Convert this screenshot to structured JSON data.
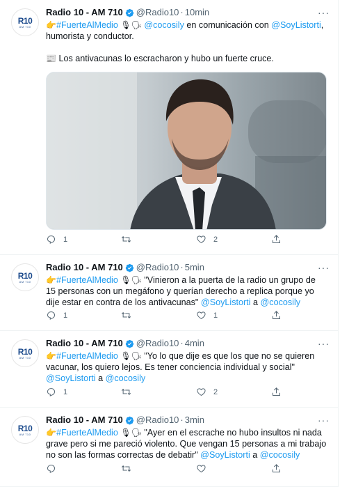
{
  "account": {
    "name": "Radio 10 - AM 710",
    "handle": "@Radio10",
    "avatar_text": "R10",
    "avatar_sub": "AM 710"
  },
  "brand_colors": {
    "link": "#1d9bf0",
    "verified": "#1d9bf0",
    "text": "#0f1419",
    "muted": "#536471"
  },
  "tweets": [
    {
      "time": "10min",
      "hashtag": "#FuerteAlMedio",
      "body": " en comunicación con ",
      "mention1": "@cocosily",
      "mention2": "@SoyListorti",
      "tail": ", humorista y conductor.",
      "para2": "Los antivacunas lo escracharon y hubo un fuerte cruce.",
      "replies": "1",
      "retweets": "",
      "likes": "2"
    },
    {
      "time": "5min",
      "hashtag": "#FuerteAlMedio",
      "body": " \"Vinieron a la puerta de la radio un grupo de 15 personas con un megáfono y querían derecho a replica porque yo dije estar en contra de los antivacunas\" ",
      "mention1": "@SoyListorti",
      "connector": " a ",
      "mention2": "@cocosily",
      "replies": "1",
      "retweets": "",
      "likes": "1"
    },
    {
      "time": "4min",
      "hashtag": "#FuerteAlMedio",
      "body": " \"Yo lo que dije es que los que no se quieren vacunar, los quiero lejos. Es tener conciencia individual y social\" ",
      "mention1": "@SoyListorti",
      "connector": " a ",
      "mention2": "@cocosily",
      "replies": "1",
      "retweets": "",
      "likes": "2"
    },
    {
      "time": "3min",
      "hashtag": "#FuerteAlMedio",
      "body": " \"Ayer en el escrache no hubo insultos ni nada grave pero si me pareció violento. Que vengan 15 personas a mi trabajo no son las formas correctas de debatir\" ",
      "mention1": "@SoyListorti",
      "connector": " a ",
      "mention2": "@cocosily",
      "replies": "",
      "retweets": "",
      "likes": ""
    }
  ],
  "glyphs": {
    "more": "···",
    "dot": "·",
    "point": "👉",
    "mic": "🎙",
    "speaking": "🗣",
    "news": "📰"
  }
}
